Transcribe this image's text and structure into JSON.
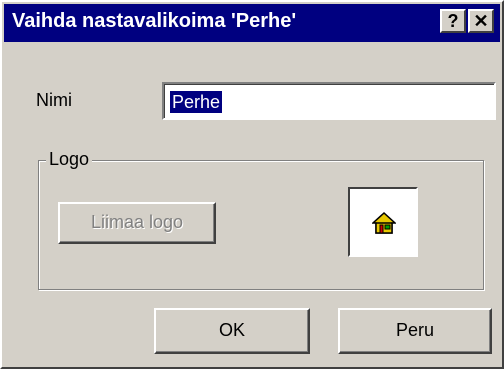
{
  "window": {
    "title": "Vaihda nastavalikoima 'Perhe'",
    "help_button": "?",
    "close_button": "✕"
  },
  "name_field": {
    "label": "Nimi",
    "value": "Perhe"
  },
  "logo_group": {
    "legend": "Logo",
    "paste_button": "Liimaa logo",
    "logo_icon": "house-icon"
  },
  "buttons": {
    "ok": "OK",
    "cancel": "Peru"
  },
  "colors": {
    "titlebar": "#000080",
    "face": "#d4d0c8",
    "selection": "#000080"
  }
}
